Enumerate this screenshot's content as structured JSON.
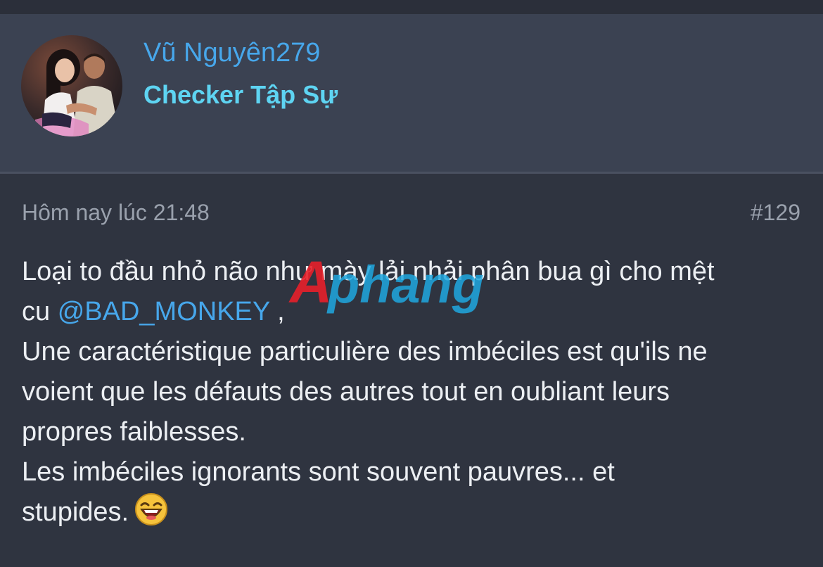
{
  "user": {
    "name": "Vũ Nguyên279",
    "title": "Checker Tập Sự"
  },
  "post": {
    "time": "Hôm nay lúc 21:48",
    "number": "#129",
    "lines": {
      "l1": "Loại to đầu nhỏ não như mày lải nhải phân bua gì cho mệt",
      "l2_prefix": "cu ",
      "l2_mention": "@BAD_MONKEY",
      "l2_suffix": " ,",
      "l3": "Une caractéristique particulière des imbéciles est qu'ils ne",
      "l4": "voient que les défauts des autres tout en oubliant leurs",
      "l5": "propres faiblesses.",
      "l6": "Les imbéciles ignorants sont souvent pauvres... et",
      "l7": "stupides."
    },
    "emoji_icon": "laughing-emoji-icon"
  },
  "watermark": {
    "text": "Aphang",
    "colors": {
      "red": "#e8202a",
      "blue": "#1fa8e0"
    }
  },
  "colors": {
    "link": "#47a7eb",
    "title": "#5ed4f2",
    "background": "#2f3440",
    "card": "#3b4252"
  }
}
